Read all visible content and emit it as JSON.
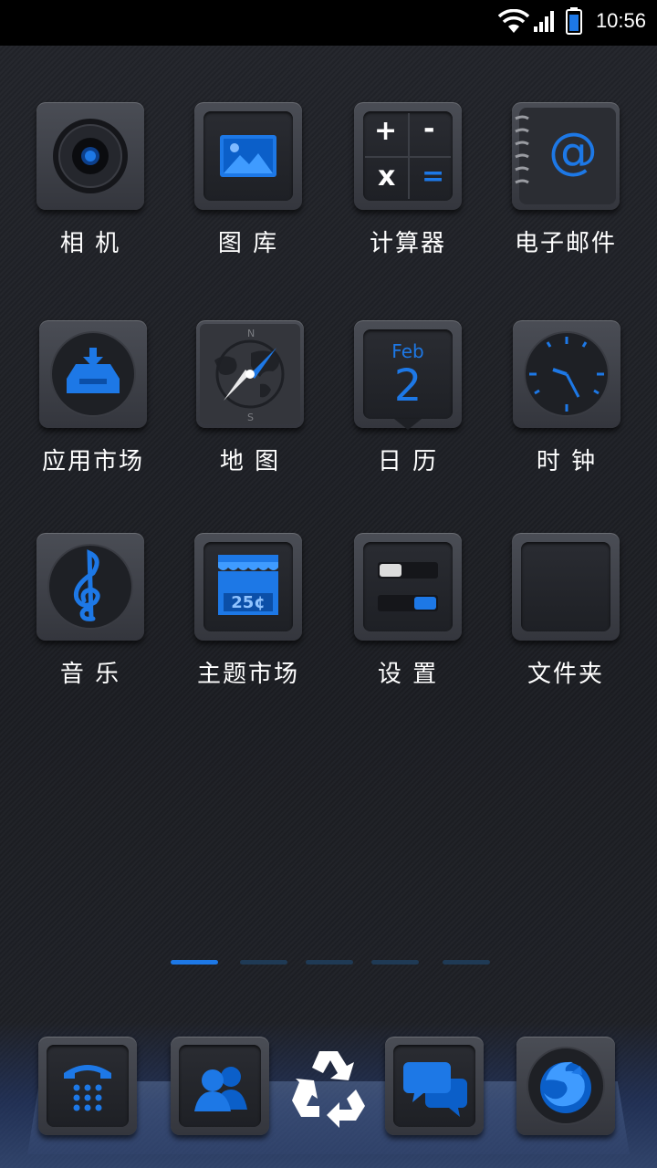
{
  "status_bar": {
    "time": "10:56",
    "icons": [
      "wifi-icon",
      "signal-icon",
      "battery-icon"
    ]
  },
  "apps": [
    {
      "label": "相 机",
      "icon": "camera-icon"
    },
    {
      "label": "图 库",
      "icon": "gallery-icon"
    },
    {
      "label": "计算器",
      "icon": "calculator-icon"
    },
    {
      "label": "电子邮件",
      "icon": "email-icon"
    },
    {
      "label": "应用市场",
      "icon": "app-market-icon"
    },
    {
      "label": "地 图",
      "icon": "map-compass-icon"
    },
    {
      "label": "日 历",
      "icon": "calendar-icon",
      "month": "Feb",
      "day": "2"
    },
    {
      "label": "时 钟",
      "icon": "clock-icon"
    },
    {
      "label": "音 乐",
      "icon": "music-icon"
    },
    {
      "label": "主题市场",
      "icon": "theme-store-icon",
      "sign": "25¢"
    },
    {
      "label": "设 置",
      "icon": "settings-icon"
    },
    {
      "label": "文件夹",
      "icon": "folder-icon"
    }
  ],
  "calculator_keys": [
    "+",
    "-",
    "x",
    "="
  ],
  "email_symbol": "@",
  "page_indicator": {
    "pages": 5,
    "current": 1
  },
  "dock": [
    {
      "icon": "phone-icon"
    },
    {
      "icon": "contacts-icon"
    },
    {
      "icon": "recycle-icon"
    },
    {
      "icon": "messages-icon"
    },
    {
      "icon": "firefox-browser-icon"
    }
  ],
  "colors": {
    "accent": "#1d78e6",
    "tile": "#3c3f46",
    "label": "#ffffff"
  }
}
